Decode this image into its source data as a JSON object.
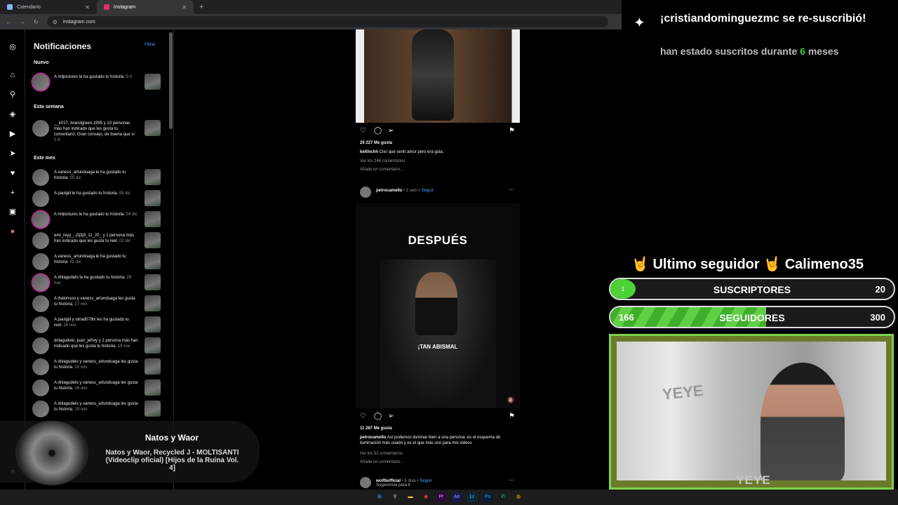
{
  "browser": {
    "tabs": [
      {
        "label": "Calendario",
        "color": "#8ab4f8"
      },
      {
        "label": "Instagram",
        "color": "#e1306c"
      }
    ],
    "url": "instagram.com"
  },
  "notifications": {
    "title": "Notificaciones",
    "filter_label": "Filtrar",
    "sections": {
      "new": "Nuevo",
      "week": "Esta semana",
      "month": "Este mes"
    },
    "new_items": [
      {
        "text": "A milpictures le ha gustado tu historia.",
        "time": "5 h"
      }
    ],
    "week_items": [
      {
        "text": "__ir017, brandgreen.1995 y 10 personas más han indicado que les gusta tu comentario: Gran consejo, de buena que sí",
        "time": "1 d"
      }
    ],
    "month_items": [
      {
        "text": "A vaness_artunduaga le ha gustado tu historia.",
        "time": "05 dic"
      },
      {
        "text": "A paulgiil le ha gustado tu historia.",
        "time": "05 dic"
      },
      {
        "text": "A milpictures le ha gustado tu historia.",
        "time": "04 dic"
      },
      {
        "text": "emi_reyy_, j3j3j3_11_20_ y 1 persona más han indicado que les gusta tu reel.",
        "time": "02 dic"
      },
      {
        "text": "A vaness_artunduaga le ha gustado tu historia.",
        "time": "01 dic"
      },
      {
        "text": "A dnlagudelo le ha gustado tu historia.",
        "time": "29 nov"
      },
      {
        "text": "A ihalonsoo y vaness_artunduaga les gusta tu historia.",
        "time": "27 nov"
      },
      {
        "text": "A paulgiil y stirad079lx les ha gustado tu reel.",
        "time": "19 nov"
      },
      {
        "text": "dnlagudelo, juan_jefrey y 1 persona más han indicado que les gusta tu historia.",
        "time": "19 nov"
      },
      {
        "text": "A dnlagudelo y vaness_artunduaga les gusta tu historia.",
        "time": "19 nov"
      },
      {
        "text": "A dnlagudelo y vaness_artunduaga les gusta tu historia.",
        "time": "19 nov"
      },
      {
        "text": "A dnlagudelo y vaness_artunduaga les gusta tu historia.",
        "time": "19 nov"
      }
    ]
  },
  "feed": {
    "post1": {
      "likes": "29 227 Me gusta",
      "user": "kellinchh",
      "caption": "Creí que sentí amor pero era gula.",
      "comments": "Ver los 246 comentarios",
      "add_comment": "Añade un comentario..."
    },
    "post2": {
      "user": "petrocamello",
      "meta": "• 1 sem •",
      "follow": "Seguir",
      "overlay_top": "DESPUÉS",
      "overlay_mid": "¡TAN ABISMAL",
      "likes": "11 287 Me gusta",
      "caption": "Así podemos iluminar bien a una persona. es el esquema de iluminación más usado y es el que más uso para mis videos",
      "comments": "Ver los 52 comentarios",
      "add_comment": "Añade un comentario..."
    },
    "post3": {
      "user": "wolfbofficial",
      "meta": "• 6 días •",
      "follow": "Seguir",
      "sub": "Sugerencia para ti"
    }
  },
  "music_overlay": {
    "artist": "Natos y Waor",
    "track": "Natos y Waor, Recycled J - MOLTISANTI (Videoclip oficial) [Hijos de la Ruina Vol. 4]"
  },
  "stream": {
    "sub_alert": {
      "title": "¡cristiandominguezmc se re-suscribió!",
      "line_pre": "han estado suscritos durante",
      "months": "6",
      "line_post": "meses"
    },
    "last_follower_label": "🤘 Ultimo seguidor 🤘",
    "last_follower": "Calimeno35",
    "subs_bar": {
      "current": "1",
      "label": "SUSCRIPTORES",
      "goal": "20",
      "fraction": 0.05
    },
    "followers_bar": {
      "current": "166",
      "label": "SEGUIDORES",
      "goal": "300",
      "fraction": 0.55
    },
    "cam_name": "YEYE"
  },
  "colors": {
    "accent_green": "#4cd137",
    "link_blue": "#4ea3ff"
  }
}
